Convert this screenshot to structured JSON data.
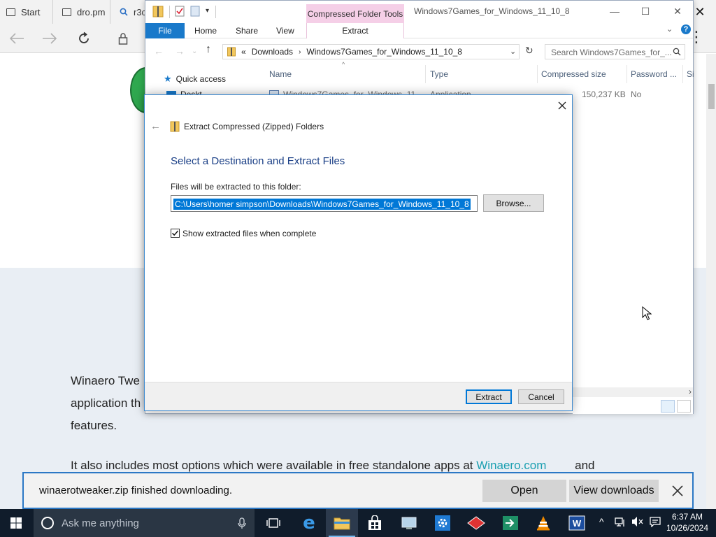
{
  "edge": {
    "tabs": [
      {
        "label": "Start"
      },
      {
        "label": "dro.pm"
      },
      {
        "label": "r3c"
      }
    ],
    "page": {
      "para1": [
        "Winaero Twe",
        "application th",
        "features."
      ],
      "para2_text": "It also includes most options which were available in free standalone apps at",
      "para2_link": "Winaero.com",
      "para2_end": "and"
    },
    "download": {
      "message": "winaerotweaker.zip finished downloading.",
      "open_label": "Open",
      "view_label": "View downloads"
    }
  },
  "explorer": {
    "title": "Windows7Games_for_Windows_11_10_8",
    "context_tab": "Compressed Folder Tools",
    "ribbon": {
      "file": "File",
      "home": "Home",
      "share": "Share",
      "view": "View",
      "extract": "Extract"
    },
    "address": {
      "prefix": "«",
      "parts": [
        "Downloads",
        "Windows7Games_for_Windows_11_10_8"
      ]
    },
    "search_placeholder": "Search Windows7Games_for_...",
    "quick_access": "Quick access",
    "nav_peek": "Deskt",
    "columns": [
      "Name",
      "Type",
      "Compressed size",
      "Password ...",
      "Si"
    ],
    "row": {
      "name": "Windows7Games_for_Windows_11...",
      "type": "Application",
      "size": "150,237 KB",
      "password": "No"
    }
  },
  "dialog": {
    "header": "Extract Compressed (Zipped) Folders",
    "heading": "Select a Destination and Extract Files",
    "label": "Files will be extracted to this folder:",
    "path": "C:\\Users\\homer simpson\\Downloads\\Windows7Games_for_Windows_11_10_8",
    "browse_label": "Browse...",
    "checkbox_label": "Show extracted files when complete",
    "checkbox_checked": true,
    "extract_label": "Extract",
    "cancel_label": "Cancel"
  },
  "taskbar": {
    "search_placeholder": "Ask me anything",
    "time": "6:37 AM",
    "date": "10/26/2024"
  },
  "colors": {
    "accent": "#0078d7",
    "taskbar": "#101c2b",
    "context_tab": "#f5cfe7",
    "heading": "#1a3f86"
  }
}
